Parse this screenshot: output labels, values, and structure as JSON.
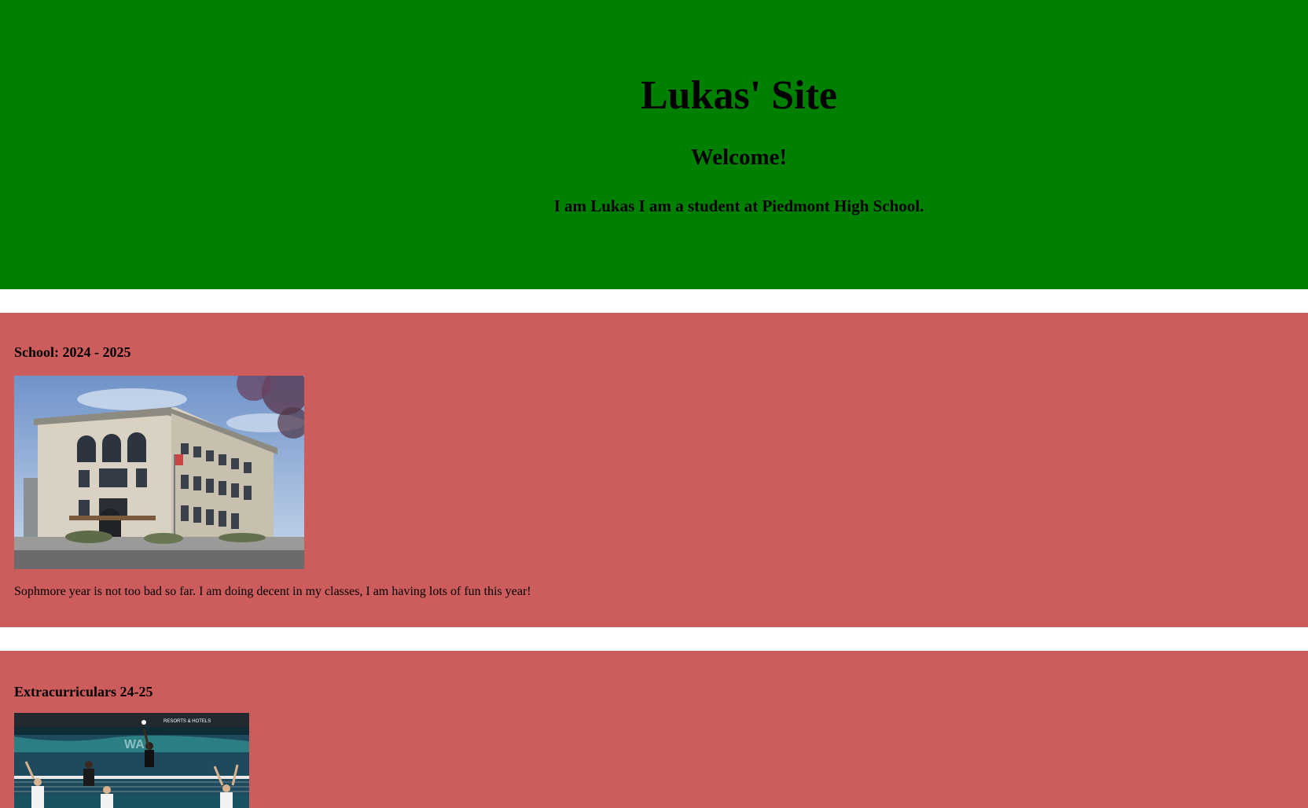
{
  "header": {
    "title": "Lukas' Site",
    "welcome": "Welcome!",
    "intro": "I am Lukas I am a student at Piedmont High School.",
    "background_color": "#008000"
  },
  "sections": [
    {
      "heading": "School: 2024 - 2025",
      "image": "school-building-photo",
      "text": "Sophmore year is not too bad so far. I am doing decent in my classes, I am having lots of fun this year!",
      "background_color": "#cd5c5c"
    },
    {
      "heading": "Extracurriculars 24-25",
      "image": "volleyball-photo",
      "background_color": "#cd5c5c"
    }
  ],
  "extra_banner_text": "RESORTS & HOTELS"
}
